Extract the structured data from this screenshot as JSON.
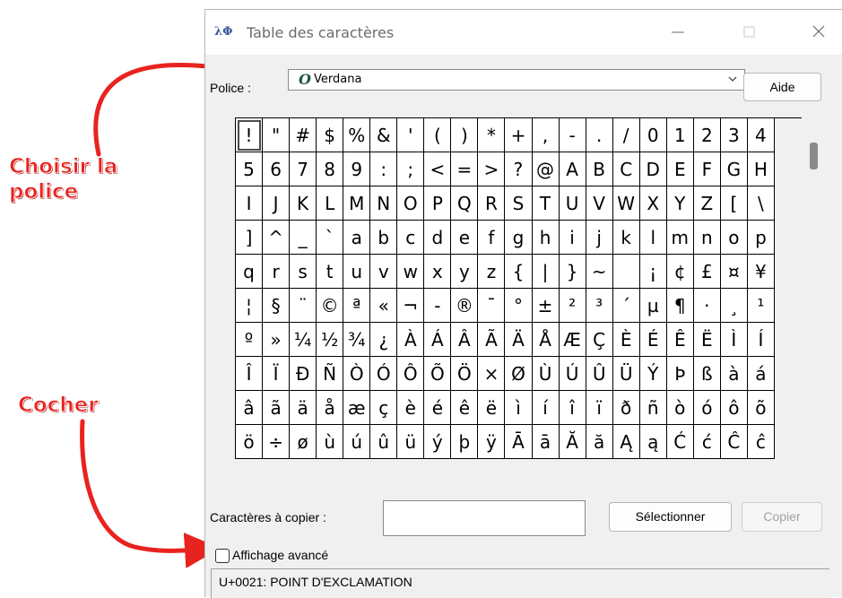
{
  "annotations": {
    "choose_font": "Choisir la\npolice",
    "check": "Cocher"
  },
  "window": {
    "icon": "character-map-icon",
    "title": "Table des caractères",
    "controls": [
      "minimize",
      "maximize",
      "close"
    ]
  },
  "font_row": {
    "label": "Police :",
    "selected_font": "Verdana",
    "font_type_icon": "opentype-font-icon",
    "help_button": "Aide"
  },
  "character_grid": {
    "selected": "!",
    "rows": [
      [
        "!",
        "\"",
        "#",
        "$",
        "%",
        "&",
        "'",
        "(",
        ")",
        "*",
        "+",
        ",",
        "-",
        ".",
        "/",
        "0",
        "1",
        "2",
        "3",
        "4"
      ],
      [
        "5",
        "6",
        "7",
        "8",
        "9",
        ":",
        ";",
        "<",
        "=",
        ">",
        "?",
        "@",
        "A",
        "B",
        "C",
        "D",
        "E",
        "F",
        "G",
        "H"
      ],
      [
        "I",
        "J",
        "K",
        "L",
        "M",
        "N",
        "O",
        "P",
        "Q",
        "R",
        "S",
        "T",
        "U",
        "V",
        "W",
        "X",
        "Y",
        "Z",
        "[",
        "\\"
      ],
      [
        "]",
        "^",
        "_",
        "`",
        "a",
        "b",
        "c",
        "d",
        "e",
        "f",
        "g",
        "h",
        "i",
        "j",
        "k",
        "l",
        "m",
        "n",
        "o",
        "p"
      ],
      [
        "q",
        "r",
        "s",
        "t",
        "u",
        "v",
        "w",
        "x",
        "y",
        "z",
        "{",
        "|",
        "}",
        "~",
        " ",
        "¡",
        "¢",
        "£",
        "¤",
        "¥"
      ],
      [
        "¦",
        "§",
        "¨",
        "©",
        "ª",
        "«",
        "¬",
        "-",
        "®",
        "¯",
        "°",
        "±",
        "²",
        "³",
        "´",
        "µ",
        "¶",
        "·",
        "¸",
        "¹"
      ],
      [
        "º",
        "»",
        "¼",
        "½",
        "¾",
        "¿",
        "À",
        "Á",
        "Â",
        "Ã",
        "Ä",
        "Å",
        "Æ",
        "Ç",
        "È",
        "É",
        "Ê",
        "Ë",
        "Ì",
        "Í"
      ],
      [
        "Î",
        "Ï",
        "Ð",
        "Ñ",
        "Ò",
        "Ó",
        "Ô",
        "Õ",
        "Ö",
        "×",
        "Ø",
        "Ù",
        "Ú",
        "Û",
        "Ü",
        "Ý",
        "Þ",
        "ß",
        "à",
        "á"
      ],
      [
        "â",
        "ã",
        "ä",
        "å",
        "æ",
        "ç",
        "è",
        "é",
        "ê",
        "ë",
        "ì",
        "í",
        "î",
        "ï",
        "ð",
        "ñ",
        "ò",
        "ó",
        "ô",
        "õ"
      ],
      [
        "ö",
        "÷",
        "ø",
        "ù",
        "ú",
        "û",
        "ü",
        "ý",
        "þ",
        "ÿ",
        "Ā",
        "ā",
        "Ă",
        "ă",
        "Ą",
        "ą",
        "Ć",
        "ć",
        "Ĉ",
        "ĉ"
      ]
    ]
  },
  "copy_row": {
    "label": "Caractères à copier :",
    "value": "",
    "select_button": "Sélectionner",
    "copy_button": "Copier"
  },
  "advanced": {
    "label": "Affichage avancé",
    "checked": false
  },
  "status": {
    "text": "U+0021: POINT D'EXCLAMATION"
  },
  "colors": {
    "annotation_red": "#e8231f",
    "window_bg": "#f0f0f0"
  }
}
